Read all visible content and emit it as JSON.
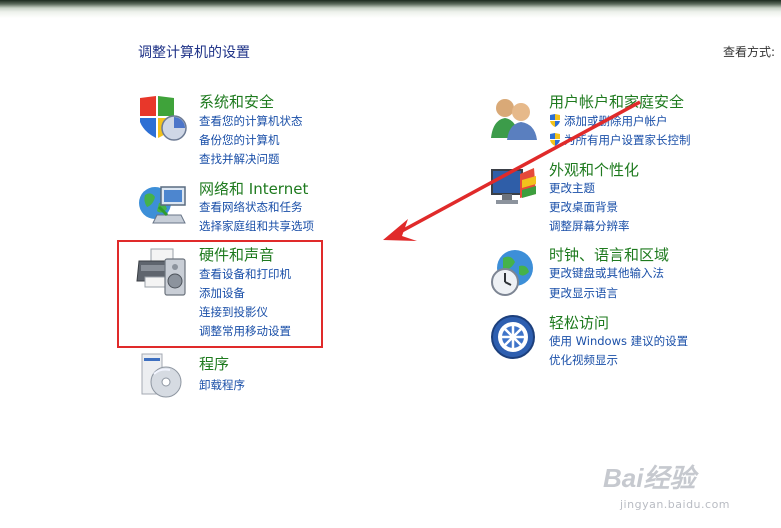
{
  "header": {
    "title": "调整计算机的设置",
    "view_by_label": "查看方式:"
  },
  "categories": {
    "system_security": {
      "title": "系统和安全",
      "links": [
        "查看您的计算机状态",
        "备份您的计算机",
        "查找并解决问题"
      ]
    },
    "network": {
      "title": "网络和 Internet",
      "links": [
        "查看网络状态和任务",
        "选择家庭组和共享选项"
      ]
    },
    "hardware_sound": {
      "title": "硬件和声音",
      "links": [
        "查看设备和打印机",
        "添加设备",
        "连接到投影仪",
        "调整常用移动设置"
      ]
    },
    "programs": {
      "title": "程序",
      "links": [
        "卸载程序"
      ]
    },
    "user_accounts": {
      "title": "用户帐户和家庭安全",
      "links": [
        "添加或删除用户帐户",
        "为所有用户设置家长控制"
      ]
    },
    "appearance": {
      "title": "外观和个性化",
      "links": [
        "更改主题",
        "更改桌面背景",
        "调整屏幕分辨率"
      ]
    },
    "clock_language": {
      "title": "时钟、语言和区域",
      "links": [
        "更改键盘或其他输入法",
        "更改显示语言"
      ]
    },
    "ease_of_access": {
      "title": "轻松访问",
      "links": [
        "使用 Windows 建议的设置",
        "优化视频显示"
      ]
    }
  },
  "annotations": {
    "highlight_color": "#e02a2a",
    "arrow_color": "#e02a2a"
  },
  "watermark": {
    "logo": "Bai经验",
    "url": "jingyan.baidu.com"
  },
  "colors": {
    "category_title": "#1e7a1e",
    "link": "#1a4fa8",
    "page_title": "#1e3287"
  }
}
